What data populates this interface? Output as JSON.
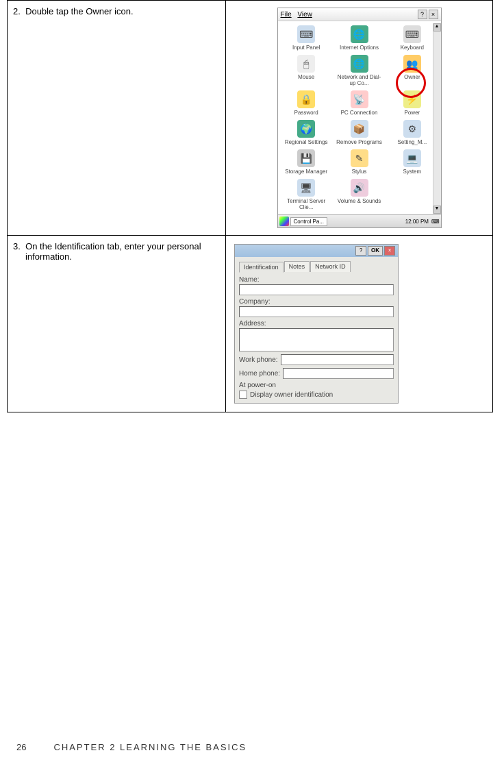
{
  "steps": [
    {
      "num": "2.",
      "text": "Double tap the Owner icon."
    },
    {
      "num": "3.",
      "text": "On the Identification tab, enter your personal information."
    }
  ],
  "controlPanel": {
    "menu": {
      "file": "File",
      "view": "View"
    },
    "icons": [
      "Input Panel",
      "Internet Options",
      "Keyboard",
      "Mouse",
      "Network and Dial-up Co...",
      "Owner",
      "Password",
      "PC Connection",
      "Power",
      "Regional Settings",
      "Remove Programs",
      "Setting_M...",
      "Storage Manager",
      "Stylus",
      "System",
      "Terminal Server Clie...",
      "Volume & Sounds"
    ],
    "taskbar": {
      "button": "Control Pa...",
      "time": "12:00 PM"
    }
  },
  "ownerDialog": {
    "ok": "OK",
    "tabs": [
      "Identification",
      "Notes",
      "Network ID"
    ],
    "labels": {
      "name": "Name:",
      "company": "Company:",
      "address": "Address:",
      "work": "Work phone:",
      "home": "Home phone:",
      "poweron": "At power-on",
      "display": "Display owner identification"
    }
  },
  "footer": {
    "page": "26",
    "chapter": "CHAPTER 2 LEARNING THE BASICS"
  }
}
